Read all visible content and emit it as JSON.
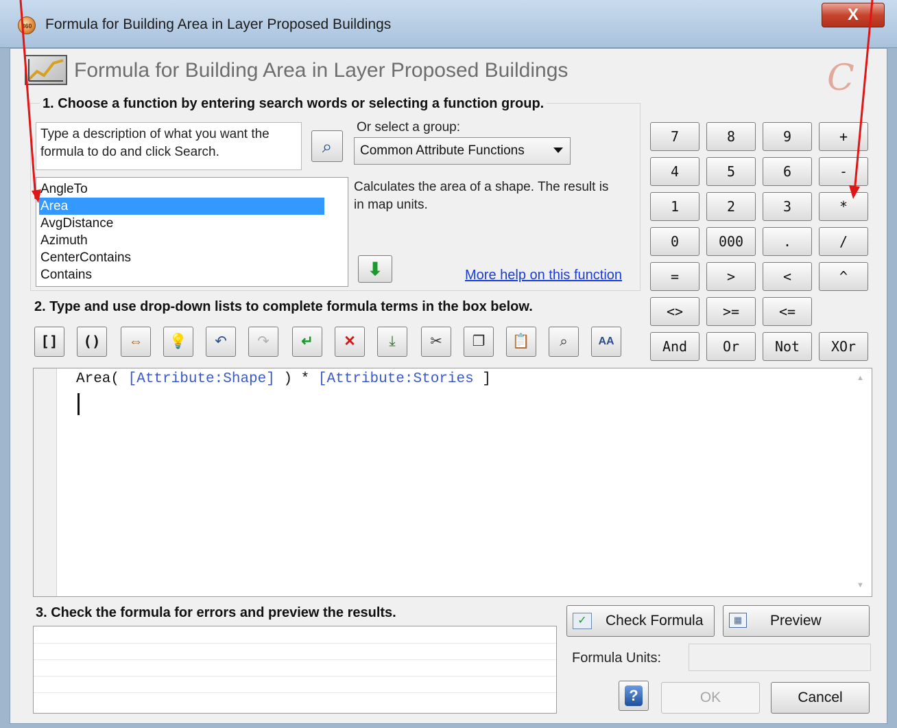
{
  "window": {
    "title": "Formula for Building Area in Layer Proposed Buildings",
    "close_label": "X",
    "app_icon_text": "360"
  },
  "header": {
    "title": "Formula for Building Area in Layer Proposed Buildings",
    "logo": "C"
  },
  "step1": {
    "label": "1. Choose a function by entering search words or selecting a function group.",
    "search_placeholder": "Type a description of what you want the formula to do and click Search.",
    "group_label": "Or select a group:",
    "group_value": "Common Attribute Functions",
    "functions": [
      "AngleTo",
      "Area",
      "AvgDistance",
      "Azimuth",
      "CenterContains",
      "Contains"
    ],
    "selected_function": "Area",
    "description": "Calculates the area of a shape.  The result is in map units.",
    "help_link": "More help on this function"
  },
  "keypad": {
    "rows": [
      [
        "7",
        "8",
        "9",
        "+"
      ],
      [
        "4",
        "5",
        "6",
        "-"
      ],
      [
        "1",
        "2",
        "3",
        "*"
      ],
      [
        "0",
        "000",
        ".",
        "/"
      ],
      [
        "=",
        ">",
        "<",
        "^"
      ],
      [
        "<>",
        ">=",
        "<="
      ],
      [
        "And",
        "Or",
        "Not",
        "XOr"
      ]
    ]
  },
  "step2": {
    "label": "2. Type and use drop-down lists to complete formula terms in the box below.",
    "tools": [
      {
        "name": "brackets",
        "glyph": "[]"
      },
      {
        "name": "parentheses",
        "glyph": "()"
      },
      {
        "name": "swap",
        "glyph": "⇔"
      },
      {
        "name": "hint",
        "glyph": "💡"
      },
      {
        "name": "undo",
        "glyph": "↶"
      },
      {
        "name": "redo",
        "glyph": "↷"
      },
      {
        "name": "apply",
        "glyph": "↵"
      },
      {
        "name": "delete",
        "glyph": "✕"
      },
      {
        "name": "load",
        "glyph": "⤓"
      },
      {
        "name": "cut",
        "glyph": "✂"
      },
      {
        "name": "copy",
        "glyph": "❐"
      },
      {
        "name": "paste",
        "glyph": "📋"
      },
      {
        "name": "find",
        "glyph": "⌕"
      },
      {
        "name": "font",
        "glyph": "AA"
      }
    ],
    "formula": {
      "func": "Area( ",
      "arg1": "[Attribute:Shape]",
      "mid": " ) * ",
      "arg2": "[Attribute:Stories",
      "end": " ]"
    }
  },
  "step3": {
    "label": "3. Check the formula for errors and preview the results.",
    "check_label": "Check Formula",
    "preview_label": "Preview",
    "units_label": "Formula Units:",
    "units_value": "",
    "ok_label": "OK",
    "cancel_label": "Cancel",
    "help_glyph": "?"
  }
}
